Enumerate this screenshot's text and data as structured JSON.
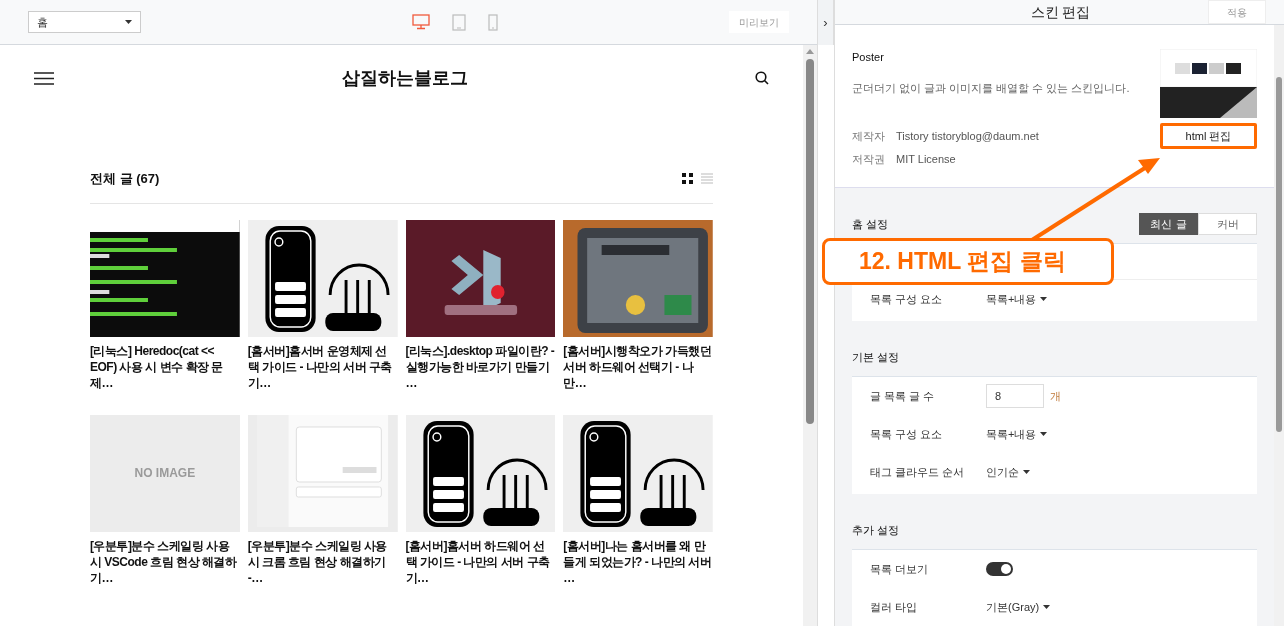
{
  "toolbar": {
    "page_select": "홈",
    "devices": [
      {
        "kind": "desktop",
        "selected": true
      },
      {
        "kind": "tablet",
        "selected": false
      },
      {
        "kind": "phone",
        "selected": false
      }
    ],
    "preview_button": "미리보기",
    "toggle": "›"
  },
  "blog": {
    "title": "삽질하는블로그",
    "list_heading": "전체 글 (67)",
    "views": [
      {
        "kind": "grid",
        "selected": true
      },
      {
        "kind": "list",
        "selected": false
      }
    ],
    "posts": [
      {
        "kind": "picture",
        "title": "[리눅스] Heredoc(cat << EOF) 사용 시 변수 확장 문제…"
      },
      {
        "kind": "picture",
        "title": "[홈서버]홈서버 운영체제 선택 가이드 - 나만의 서버 구축기…"
      },
      {
        "kind": "picture",
        "title": "[리눅스].desktop 파일이란? - 실행가능한 바로가기 만들기 …"
      },
      {
        "kind": "picture",
        "title": "[홈서버]시행착오가 가득했던 서버 하드웨어 선택기 - 나만…"
      },
      {
        "kind": "no_image",
        "placeholder": "NO IMAGE",
        "title": "[우분투]분수 스케일링 사용 시 VSCode 흐림 현상 해결하기…"
      },
      {
        "kind": "picture",
        "title": "[우분투]분수 스케일링 사용 시 크롬 흐림 현상 해결하기 -…"
      },
      {
        "kind": "picture",
        "title": "[홈서버]홈서버 하드웨어 선택 가이드 - 나만의 서버 구축기…"
      },
      {
        "kind": "picture",
        "title": "[홈서버]나는 홈서버를 왜 만들게 되었는가? - 나만의 서버 …"
      }
    ]
  },
  "skin_panel": {
    "title": "스킨 편집",
    "apply_button": "적용",
    "skin_name": "Poster",
    "description": "군더더기 없이 글과 이미지를 배열할 수 있는 스킨입니다.",
    "meta": [
      {
        "label": "제작자",
        "value": "Tistory tistoryblog@daum.net"
      },
      {
        "label": "저작권",
        "value": "MIT License"
      }
    ],
    "html_edit_button": "html 편집",
    "sections": [
      {
        "title": "홈 설정",
        "tabs": [
          {
            "label": "최신 글",
            "selected": true
          },
          {
            "label": "커버",
            "selected": false
          }
        ],
        "rows": [
          {
            "kind": "select",
            "label": "목록 구성 요소",
            "value": "목록+내용"
          }
        ]
      },
      {
        "title": "기본 설정",
        "rows": [
          {
            "kind": "input",
            "label": "글 목록 글 수",
            "value": "8",
            "unit": "개"
          },
          {
            "kind": "select",
            "label": "목록 구성 요소",
            "value": "목록+내용"
          },
          {
            "kind": "select",
            "label": "태그 클라우드 순서",
            "value": "인기순"
          }
        ]
      },
      {
        "title": "추가 설정",
        "rows": [
          {
            "kind": "toggle",
            "label": "목록 더보기",
            "on": true
          },
          {
            "kind": "select",
            "label": "컬러 타입",
            "value": "기본(Gray)"
          }
        ]
      }
    ]
  },
  "callout": {
    "text": "12. HTML 편집 클릭"
  }
}
